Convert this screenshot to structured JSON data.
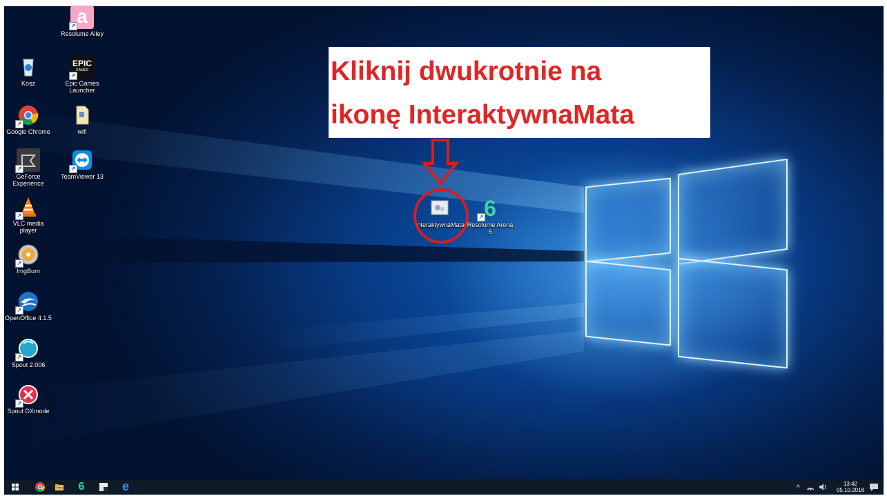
{
  "callout": {
    "line1": "Kliknij dwukrotnie na",
    "line2": "ikonę InteraktywnaMata"
  },
  "desktop_icons": {
    "resolume_alley": "Resolume Alley",
    "kosz": "Kosz",
    "epic_line1": "Epic Games",
    "epic_line2": "Launcher",
    "epic_logo": "EPIC",
    "epic_logo_sub": "GAMES",
    "chrome": "Google Chrome",
    "wifi": "wifi",
    "geforce": "GeForce Experience",
    "teamviewer": "TeamViewer 13",
    "vlc": "VLC media player",
    "imgburn": "ImgBurn",
    "openoffice": "OpenOffice 4.1.5",
    "spout": "Spout 2.006",
    "spout_dx": "Spout DXmode",
    "interaktywna": "InteraktywnaMata",
    "resolume_arena": "Resolume Arena 6",
    "arena_glyph": "6"
  },
  "taskbar": {
    "time": "13:42",
    "date": "05.10.2018",
    "tray_chevron": "^",
    "resolume_glyph": "6",
    "edge_glyph": "e"
  },
  "colors": {
    "callout_text": "#e02525",
    "annotation": "#d81e1e",
    "taskbar_bg": "#0e1a28"
  }
}
